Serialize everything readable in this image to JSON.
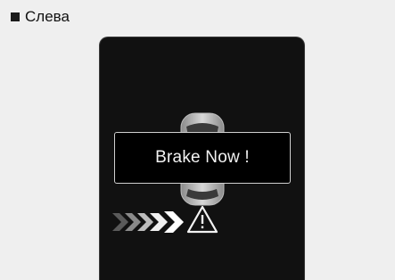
{
  "section": {
    "bullet_icon": "square-bullet-icon",
    "title": "Слева"
  },
  "display": {
    "warning_message": "Brake Now !",
    "icons": [
      "car-top-view-icon",
      "approach-arrows-icon",
      "warning-triangle-icon"
    ],
    "colors": {
      "screen_background": "#111111",
      "text": "#f2f2f2",
      "border": "#cfcfcf"
    }
  }
}
